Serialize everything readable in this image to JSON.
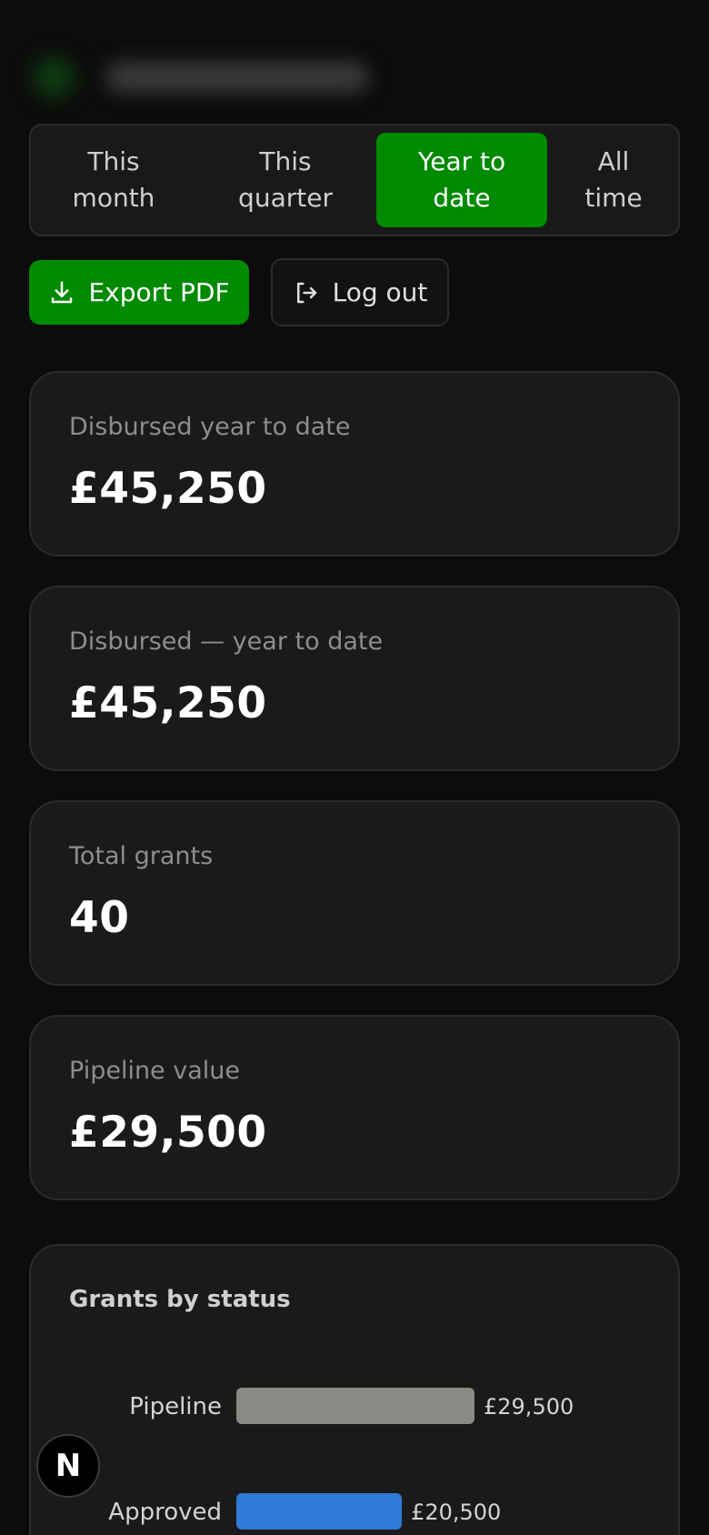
{
  "period_tabs": [
    {
      "line1": "This",
      "line2": "month"
    },
    {
      "line1": "This",
      "line2": "quarter"
    },
    {
      "line1": "Year to",
      "line2": "date"
    },
    {
      "line1": "All",
      "line2": "time"
    }
  ],
  "active_tab": "Year to date",
  "actions": {
    "export_label": "Export PDF",
    "export_icon": "download-icon",
    "logout_label": "Log out",
    "logout_icon": "logout-icon"
  },
  "stats": [
    {
      "label": "Disbursed year to date",
      "value": "£45,250"
    },
    {
      "label": "Disbursed — year to date",
      "value": "£45,250"
    },
    {
      "label": "Total grants",
      "value": "40"
    },
    {
      "label": "Pipeline value",
      "value": "£29,500"
    }
  ],
  "chart": {
    "title": "Grants by status"
  },
  "chart_data": {
    "type": "bar",
    "orientation": "horizontal",
    "title": "Grants by status",
    "categories": [
      "Pipeline",
      "Approved"
    ],
    "values": [
      29500,
      20500
    ],
    "value_labels": [
      "£29,500",
      "£20,500"
    ],
    "colors": [
      "#8a8984",
      "#2f7ad8"
    ],
    "xlim": [
      0,
      29500
    ]
  },
  "badge": {
    "label": "N",
    "icon": "nextjs-logo-icon"
  },
  "colors": {
    "accent": "#008a00",
    "background": "#0c0c0c",
    "card": "#1a1a1a"
  }
}
